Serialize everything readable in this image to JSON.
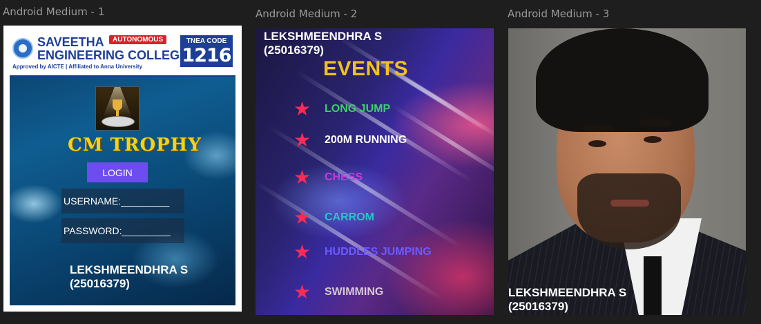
{
  "frames": [
    {
      "label": "Android Medium - 1"
    },
    {
      "label": "Android Medium - 2"
    },
    {
      "label": "Android Medium - 3"
    }
  ],
  "login_screen": {
    "college_name_line1": "SAVEETHA",
    "college_name_line2": "ENGINEERING COLLEGE",
    "autonomous_badge": "AUTONOMOUS",
    "approval_line": "Approved by AICTE  |  Affiliated to Anna University",
    "tnea_label": "TNEA CODE",
    "tnea_code": "1216",
    "title": "CM  TROPHY",
    "login_button": "LOGIN",
    "username_label": "USERNAME:_________",
    "password_label": "PASSWORD:_________",
    "footer_name": "LEKSHMEENDHRA S",
    "footer_id": "(25016379)"
  },
  "events_screen": {
    "name": "LEKSHMEENDHRA S",
    "id": "(25016379)",
    "title": "EVENTS",
    "events": [
      {
        "label": "LONG JUMP",
        "color": "#3ecf6a"
      },
      {
        "label": "200M RUNNING",
        "color": "#ffffff"
      },
      {
        "label": "CHESS",
        "color": "#c23ddb"
      },
      {
        "label": "CARROM",
        "color": "#2bc3c8"
      },
      {
        "label": "HUDDLES JUMPING",
        "color": "#6a5cff"
      },
      {
        "label": "SWIMMING",
        "color": "#d8c8d8"
      }
    ],
    "star_color": "#ff2a55",
    "title_color": "#f2c21e"
  },
  "profile_screen": {
    "name": "LEKSHMEENDHRA S",
    "id": "(25016379)"
  }
}
